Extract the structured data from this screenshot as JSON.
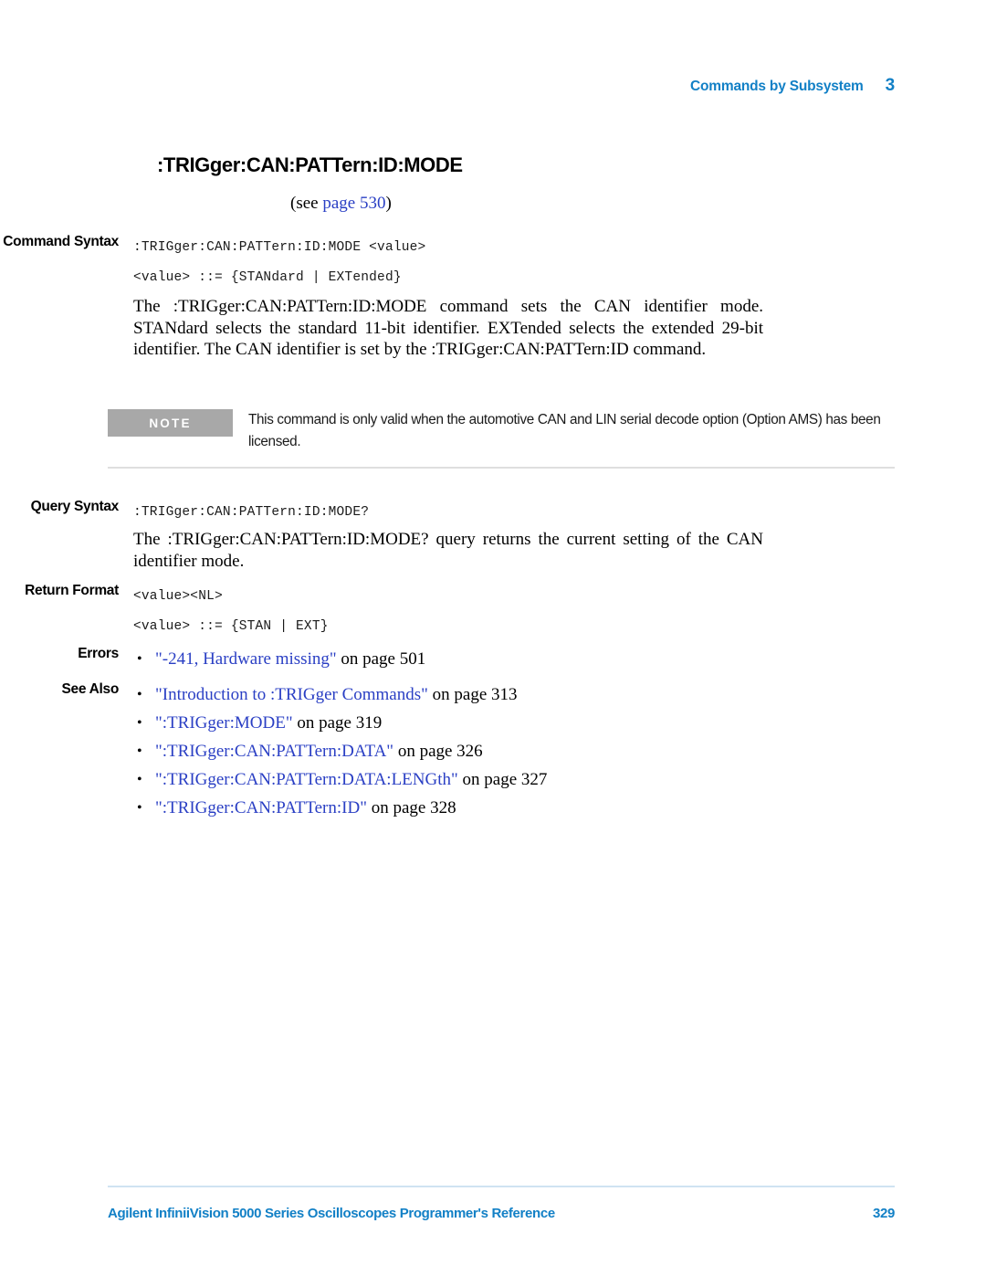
{
  "header": {
    "chapter_title": "Commands by Subsystem",
    "chapter_number": "3"
  },
  "command": {
    "title": ":TRIGger:CAN:PATTern:ID:MODE",
    "see_prefix": "(see ",
    "see_link": "page 530",
    "see_suffix": ")"
  },
  "command_syntax": {
    "label": "Command Syntax",
    "line1": ":TRIGger:CAN:PATTern:ID:MODE <value>",
    "line2": "<value> ::= {STANdard | EXTended}"
  },
  "description": {
    "text": "The :TRIGger:CAN:PATTern:ID:MODE command sets the CAN identifier mode. STANdard selects the standard 11-bit identifier. EXTended selects the extended 29-bit identifier. The CAN identifier is set by the :TRIGger:CAN:PATTern:ID command."
  },
  "note": {
    "badge": "NOTE",
    "text": "This command is only valid when the automotive CAN and LIN serial decode option (Option AMS) has been licensed."
  },
  "query_syntax": {
    "label": "Query Syntax",
    "line1": ":TRIGger:CAN:PATTern:ID:MODE?"
  },
  "query_description": {
    "text": "The :TRIGger:CAN:PATTern:ID:MODE? query returns the current setting of the CAN identifier mode."
  },
  "return_format": {
    "label": "Return Format",
    "line1": "<value><NL>",
    "line2": "<value> ::= {STAN | EXT}"
  },
  "errors": {
    "label": "Errors",
    "items": [
      {
        "link": "\"-241, Hardware missing\"",
        "tail": " on page 501"
      }
    ]
  },
  "see_also": {
    "label": "See Also",
    "items": [
      {
        "link": "\"Introduction to :TRIGger Commands\"",
        "tail": " on page 313"
      },
      {
        "link": "\":TRIGger:MODE\"",
        "tail": " on page 319"
      },
      {
        "link": "\":TRIGger:CAN:PATTern:DATA\"",
        "tail": " on page 326"
      },
      {
        "link": "\":TRIGger:CAN:PATTern:DATA:LENGth\"",
        "tail": " on page 327"
      },
      {
        "link": "\":TRIGger:CAN:PATTern:ID\"",
        "tail": " on page 328"
      }
    ]
  },
  "footer": {
    "document_title": "Agilent InfiniiVision 5000 Series Oscilloscopes Programmer's Reference",
    "page_number": "329"
  },
  "colors": {
    "agilent_blue": "#1280C6",
    "link_blue": "#2A3FC4",
    "note_gray": "#A8A8A8",
    "rule_gray": "#DFDFDF"
  }
}
